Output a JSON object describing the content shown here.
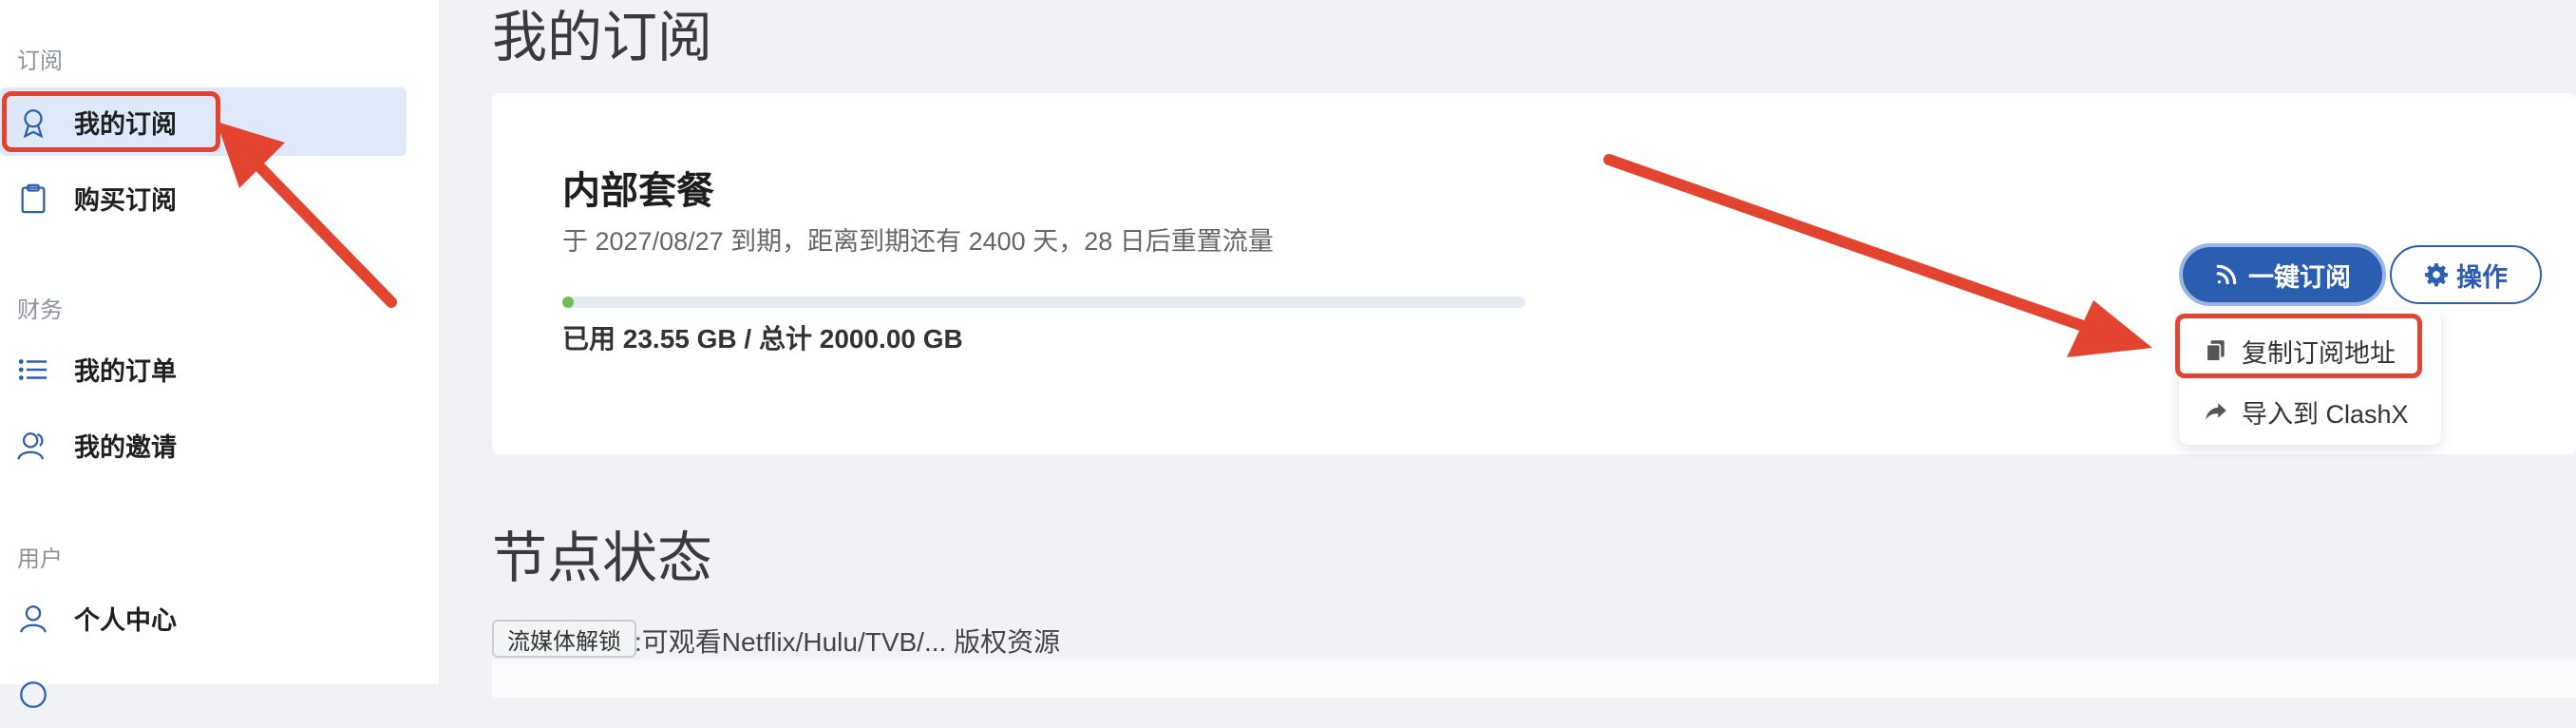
{
  "sidebar": {
    "sections": [
      {
        "title": "订阅",
        "items": [
          {
            "label": "我的订阅",
            "icon": "badge-icon",
            "active": true
          },
          {
            "label": "购买订阅",
            "icon": "clipboard-icon",
            "active": false
          }
        ]
      },
      {
        "title": "财务",
        "items": [
          {
            "label": "我的订单",
            "icon": "list-icon",
            "active": false
          },
          {
            "label": "我的邀请",
            "icon": "users-icon",
            "active": false
          }
        ]
      },
      {
        "title": "用户",
        "items": [
          {
            "label": "个人中心",
            "icon": "user-icon",
            "active": false
          }
        ]
      }
    ]
  },
  "main": {
    "title": "我的订阅",
    "plan": {
      "name": "内部套餐",
      "expiry_text": "于 2027/08/27 到期，距离到期还有 2400 天，28 日后重置流量",
      "usage_text": "已用 23.55 GB / 总计 2000.00 GB",
      "usage_fraction": 0.0118
    },
    "buttons": {
      "subscribe": "一键订阅",
      "operations": "操作"
    },
    "dropdown": [
      {
        "label": "复制订阅地址",
        "icon": "copy-icon"
      },
      {
        "label": "导入到 ClashX",
        "icon": "share-icon"
      }
    ],
    "node_section": {
      "title": "节点状态",
      "tag": "流媒体解锁",
      "desc": ":可观看Netflix/Hulu/TVB/... 版权资源"
    }
  },
  "colors": {
    "accent": "#2b5db1",
    "annotation": "#e2442f",
    "progress": "#6cbf57",
    "active_bg": "#dde9f9"
  }
}
